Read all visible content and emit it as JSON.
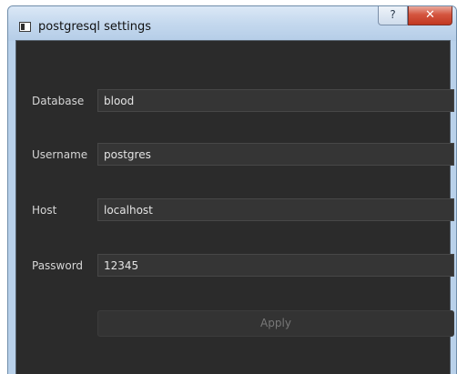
{
  "window": {
    "title": "postgresql settings",
    "help_glyph": "?",
    "close_glyph": "✕"
  },
  "form": {
    "database": {
      "label": "Database",
      "value": "blood"
    },
    "username": {
      "label": "Username",
      "value": "postgres"
    },
    "host": {
      "label": "Host",
      "value": "localhost"
    },
    "password": {
      "label": "Password",
      "value": "12345"
    }
  },
  "apply_label": "Apply",
  "icons": {
    "app": "window-app-icon",
    "help": "help-icon",
    "close": "close-icon"
  },
  "colors": {
    "background": "#2b2b2b",
    "field_background": "#353535",
    "close_button": "#c23821"
  }
}
